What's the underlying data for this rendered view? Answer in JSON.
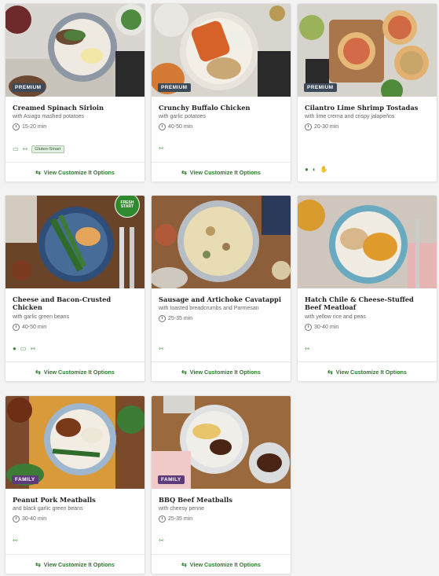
{
  "cards": [
    {
      "title": "Creamed Spinach Sirloin",
      "subtitle": "with Asiago mashed potatoes",
      "time": "15-20 min",
      "badge": "PREMIUM",
      "tag": "Gluten-Smart",
      "action": "View Customize It Options"
    },
    {
      "title": "Crunchy Buffalo Chicken",
      "subtitle": "with garlic potatoes",
      "time": "40-50 min",
      "badge": "PREMIUM",
      "action": "View Customize It Options"
    },
    {
      "title": "Cilantro Lime Shrimp Tostadas",
      "subtitle": "with lime crema and crispy jalapeños",
      "time": "20-30 min",
      "badge": "PREMIUM",
      "action": "View Customize It Options"
    },
    {
      "title": "Cheese and Bacon-Crusted Chicken",
      "subtitle": "with garlic green beans",
      "time": "40-50 min",
      "fresh_label": "FRESH START",
      "action": "View Customize It Options"
    },
    {
      "title": "Sausage and Artichoke Cavatappi",
      "subtitle": "with toasted breadcrumbs and Parmesan",
      "time": "25-35 min",
      "action": "View Customize It Options"
    },
    {
      "title": "Hatch Chile & Cheese-Stuffed Beef Meatloaf",
      "subtitle": "with yellow rice and peas",
      "time": "30-40 min",
      "action": "View Customize It Options"
    },
    {
      "title": "Peanut Pork Meatballs",
      "subtitle": "and black garlic green beans",
      "time": "30-40 min",
      "badge": "FAMILY",
      "action": "View Customize It Options"
    },
    {
      "title": "BBQ Beef Meatballs",
      "subtitle": "with cheesy penne",
      "time": "25-35 min",
      "badge": "FAMILY",
      "action": "View Customize It Options"
    }
  ]
}
